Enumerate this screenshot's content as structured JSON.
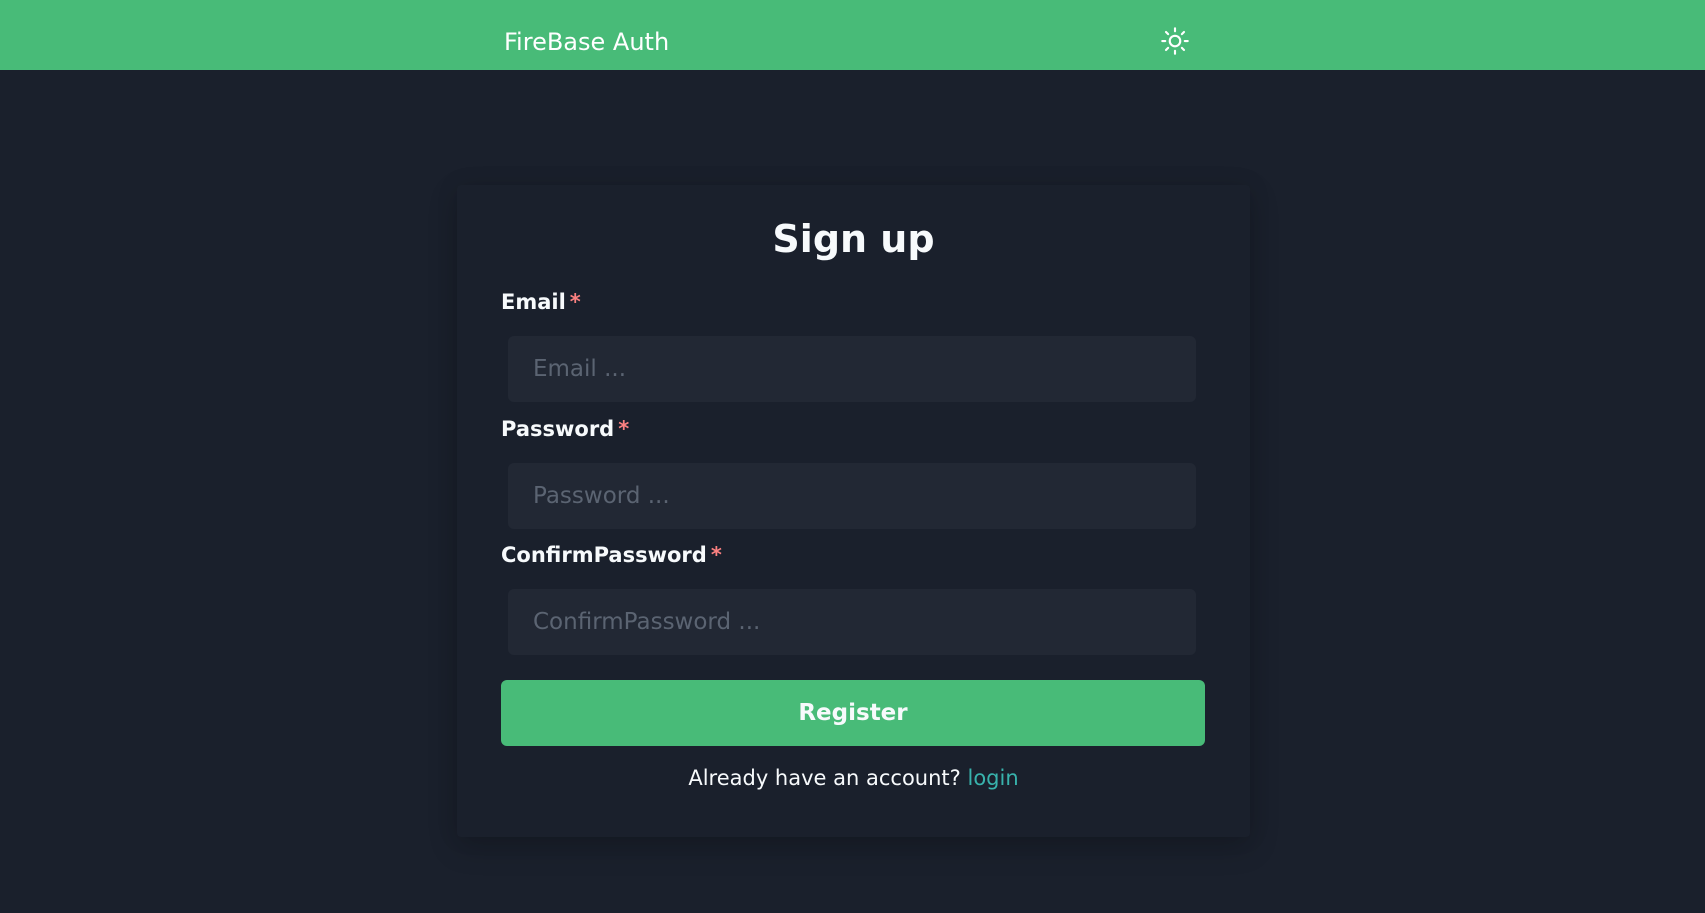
{
  "colors": {
    "navbar_bg": "#48bb78",
    "page_bg": "#1a202c",
    "input_bg": "#222834",
    "button_bg": "#48bb78",
    "required_mark": "#fc8181",
    "link": "#38b2ac"
  },
  "navbar": {
    "brand": "FireBase Auth",
    "theme_toggle_icon": "sun-icon"
  },
  "form": {
    "title": "Sign up",
    "email": {
      "label": "Email",
      "required_mark": "*",
      "placeholder": "Email ...",
      "value": ""
    },
    "password": {
      "label": "Password",
      "required_mark": "*",
      "placeholder": "Password ...",
      "value": ""
    },
    "confirm_password": {
      "label": "ConfirmPassword",
      "required_mark": "*",
      "placeholder": "ConfirmPassword ...",
      "value": ""
    },
    "submit_label": "Register",
    "footer_text": "Already have an account?",
    "login_link": "login"
  }
}
